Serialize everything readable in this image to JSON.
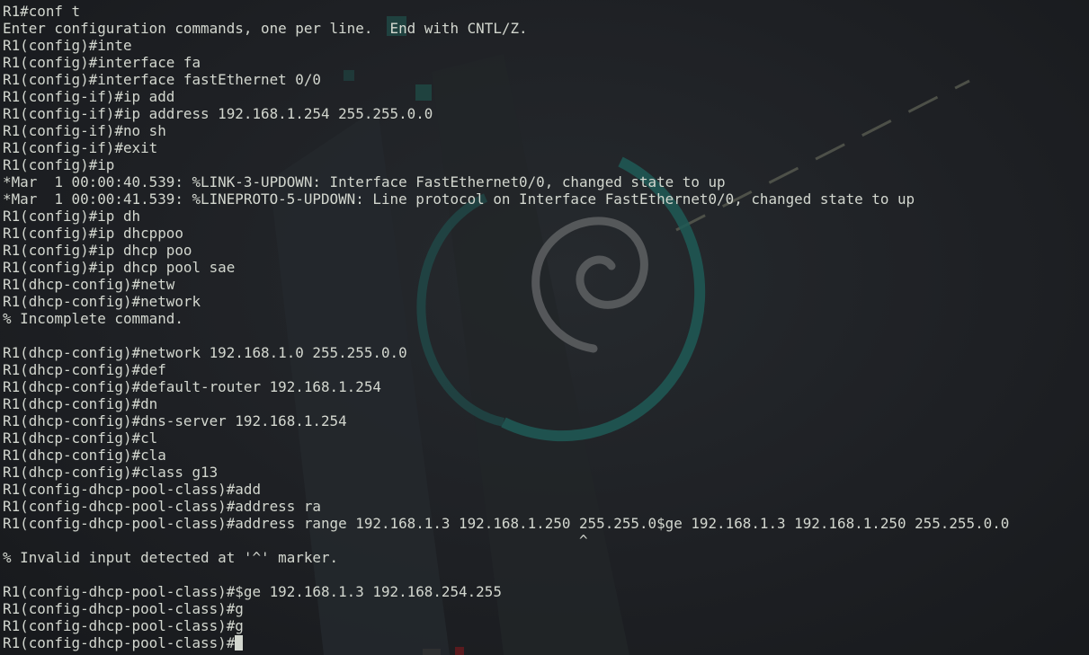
{
  "terminal": {
    "lines": [
      "R1#conf t",
      "Enter configuration commands, one per line.  End with CNTL/Z.",
      "R1(config)#inte",
      "R1(config)#interface fa",
      "R1(config)#interface fastEthernet 0/0",
      "R1(config-if)#ip add",
      "R1(config-if)#ip address 192.168.1.254 255.255.0.0",
      "R1(config-if)#no sh",
      "R1(config-if)#exit",
      "R1(config)#ip",
      "*Mar  1 00:00:40.539: %LINK-3-UPDOWN: Interface FastEthernet0/0, changed state to up",
      "*Mar  1 00:00:41.539: %LINEPROTO-5-UPDOWN: Line protocol on Interface FastEthernet0/0, changed state to up",
      "R1(config)#ip dh",
      "R1(config)#ip dhcppoo",
      "R1(config)#ip dhcp poo",
      "R1(config)#ip dhcp pool sae",
      "R1(dhcp-config)#netw",
      "R1(dhcp-config)#network",
      "% Incomplete command.",
      "",
      "R1(dhcp-config)#network 192.168.1.0 255.255.0.0",
      "R1(dhcp-config)#def",
      "R1(dhcp-config)#default-router 192.168.1.254",
      "R1(dhcp-config)#dn",
      "R1(dhcp-config)#dns-server 192.168.1.254",
      "R1(dhcp-config)#cl",
      "R1(dhcp-config)#cla",
      "R1(dhcp-config)#class g13",
      "R1(config-dhcp-pool-class)#add",
      "R1(config-dhcp-pool-class)#address ra",
      "R1(config-dhcp-pool-class)#address range 192.168.1.3 192.168.1.250 255.255.0$ge 192.168.1.3 192.168.1.250 255.255.0.0",
      "                                                                   ^",
      "% Invalid input detected at '^' marker.",
      "",
      "R1(config-dhcp-pool-class)#$ge 192.168.1.3 192.168.254.255",
      "R1(config-dhcp-pool-class)#g",
      "R1(config-dhcp-pool-class)#g"
    ],
    "prompt": "R1(config-dhcp-pool-class)#"
  },
  "colors": {
    "text": "#d3d7cf",
    "background": "#1e2024",
    "accent_teal": "#1f5a56"
  },
  "wallpaper": {
    "icon": "debian-swirl-logo"
  }
}
